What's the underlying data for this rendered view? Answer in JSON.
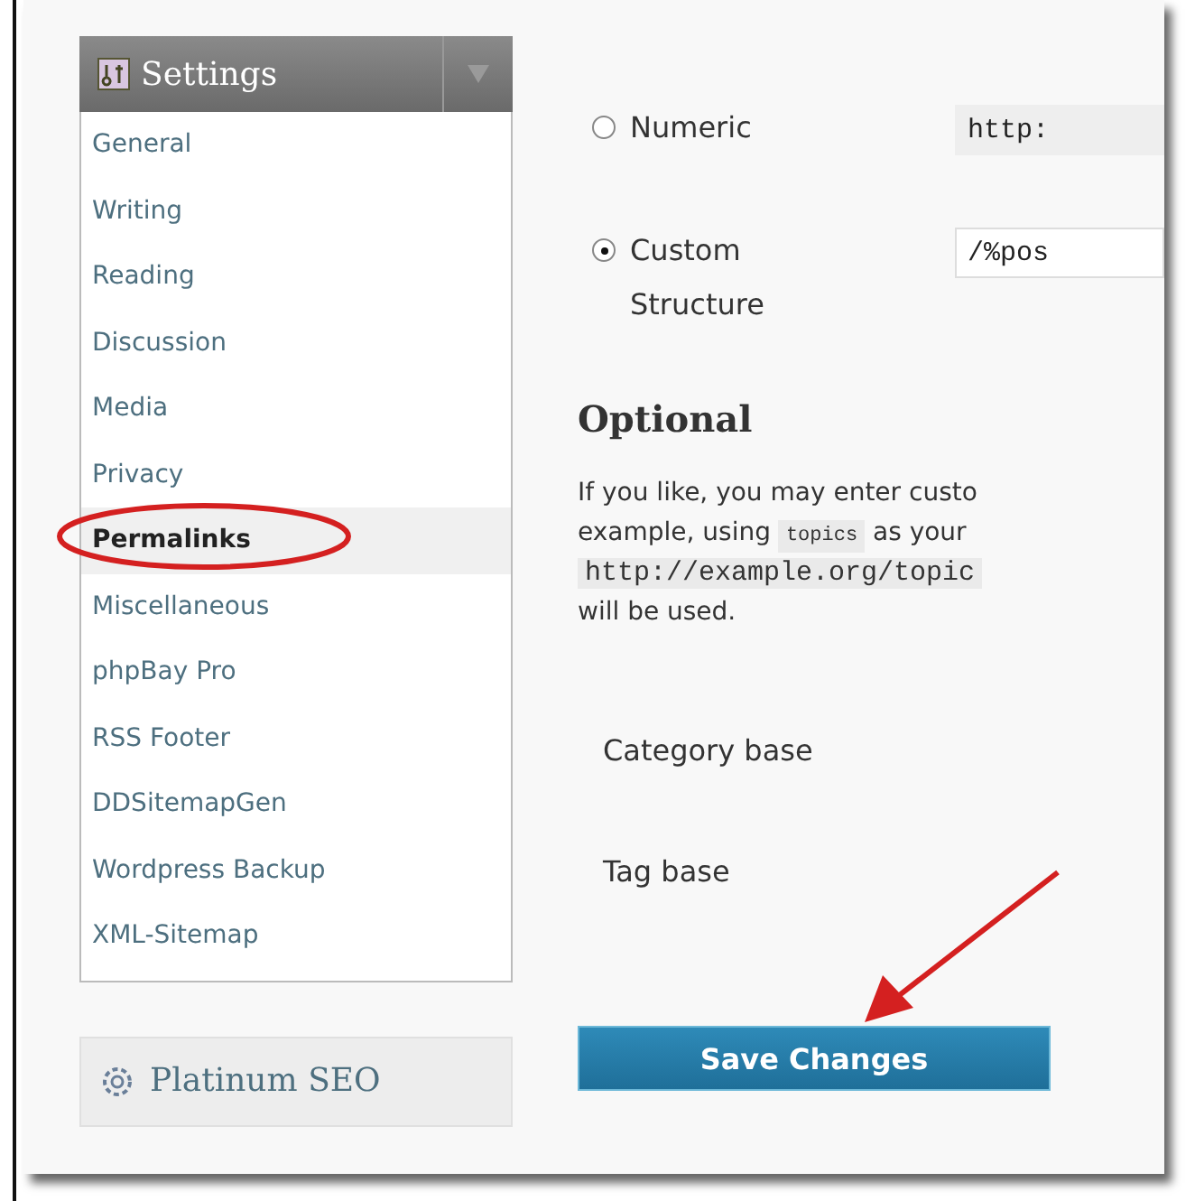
{
  "sidebar": {
    "header": {
      "title": "Settings"
    },
    "items": [
      {
        "label": "General",
        "selected": false
      },
      {
        "label": "Writing",
        "selected": false
      },
      {
        "label": "Reading",
        "selected": false
      },
      {
        "label": "Discussion",
        "selected": false
      },
      {
        "label": "Media",
        "selected": false
      },
      {
        "label": "Privacy",
        "selected": false
      },
      {
        "label": "Permalinks",
        "selected": true
      },
      {
        "label": "Miscellaneous",
        "selected": false
      },
      {
        "label": "phpBay Pro",
        "selected": false
      },
      {
        "label": "RSS Footer",
        "selected": false
      },
      {
        "label": "DDSitemapGen",
        "selected": false
      },
      {
        "label": "Wordpress Backup",
        "selected": false
      },
      {
        "label": "XML-Sitemap",
        "selected": false
      }
    ],
    "plugin_menu": {
      "title": "Platinum SEO"
    }
  },
  "permalink_options": [
    {
      "label": "Numeric",
      "selected": false,
      "example": "http:"
    },
    {
      "label": "Custom Structure",
      "selected": true,
      "example": "/%pos"
    }
  ],
  "optional": {
    "heading": "Optional",
    "paragraph": [
      [
        {
          "kind": "text",
          "text": "If you like, you may enter custo"
        }
      ],
      [
        {
          "kind": "text",
          "text": "example, using "
        },
        {
          "kind": "code",
          "text": "topics"
        },
        {
          "kind": "text",
          "text": " as your"
        }
      ],
      [
        {
          "kind": "code",
          "text": "http://example.org/topic"
        }
      ],
      [
        {
          "kind": "text",
          "text": "will be used."
        }
      ]
    ],
    "fields": [
      "Category base",
      "Tag base"
    ]
  },
  "save_button": "Save Changes"
}
